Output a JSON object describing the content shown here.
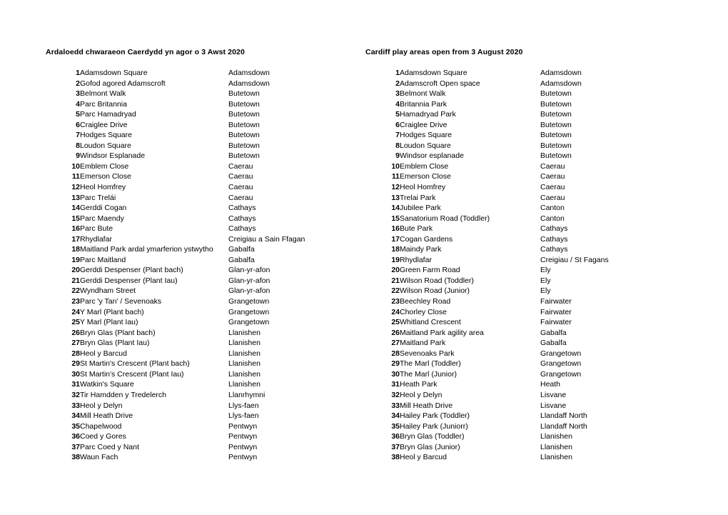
{
  "document": {
    "heading_left": "Ardaloedd chwaraeon Caerdydd yn agor o 3 Awst 2020",
    "heading_right": "Cardiff play areas open from 3 August 2020",
    "text_color": "#000000",
    "background_color": "#ffffff"
  },
  "tables": {
    "welsh": {
      "rows": [
        {
          "num": "1",
          "name": "Adamsdown Square",
          "area": "Adamsdown"
        },
        {
          "num": "2",
          "name": "Gofod agored Adamscroft",
          "area": "Adamsdown"
        },
        {
          "num": "3",
          "name": "Belmont Walk",
          "area": "Butetown"
        },
        {
          "num": "4",
          "name": "Parc Britannia",
          "area": "Butetown"
        },
        {
          "num": "5",
          "name": "Parc Hamadryad",
          "area": "Butetown"
        },
        {
          "num": "6",
          "name": "Craiglee Drive",
          "area": "Butetown"
        },
        {
          "num": "7",
          "name": "Hodges Square",
          "area": "Butetown"
        },
        {
          "num": "8",
          "name": "Loudon Square",
          "area": "Butetown"
        },
        {
          "num": "9",
          "name": "Windsor Esplanade",
          "area": "Butetown"
        },
        {
          "num": "10",
          "name": "Emblem Close",
          "area": "Caerau"
        },
        {
          "num": "11",
          "name": "Emerson Close",
          "area": "Caerau"
        },
        {
          "num": "12",
          "name": "Heol Homfrey",
          "area": "Caerau"
        },
        {
          "num": "13",
          "name": "Parc Trelái",
          "area": "Caerau"
        },
        {
          "num": "14",
          "name": "Gerddi Cogan",
          "area": "Cathays"
        },
        {
          "num": "15",
          "name": "Parc Maendy",
          "area": "Cathays"
        },
        {
          "num": "16",
          "name": "Parc Bute",
          "area": "Cathays"
        },
        {
          "num": "17",
          "name": "Rhydlafar",
          "area": "Creigiau a Sain Ffagan"
        },
        {
          "num": "18",
          "name": "Maitland Park ardal ymarferion ystwytho",
          "area": "Gabalfa"
        },
        {
          "num": "19",
          "name": "Parc Maitland",
          "area": "Gabalfa"
        },
        {
          "num": "20",
          "name": "Gerddi Despenser (Plant bach)",
          "area": "Glan-yr-afon"
        },
        {
          "num": "21",
          "name": "Gerddi Despenser (Plant Iau)",
          "area": "Glan-yr-afon"
        },
        {
          "num": "22",
          "name": "Wyndham Street",
          "area": "Glan-yr-afon"
        },
        {
          "num": "23",
          "name": "Parc 'y Tan' / Sevenoaks",
          "area": "Grangetown"
        },
        {
          "num": "24",
          "name": "Y Marl (Plant bach)",
          "area": "Grangetown"
        },
        {
          "num": "25",
          "name": "Y Marl (Plant Iau)",
          "area": "Grangetown"
        },
        {
          "num": "26",
          "name": "Bryn Glas (Plant bach)",
          "area": "Llanishen"
        },
        {
          "num": "27",
          "name": "Bryn Glas (Plant Iau)",
          "area": "Llanishen"
        },
        {
          "num": "28",
          "name": "Heol y Barcud",
          "area": "Llanishen"
        },
        {
          "num": "29",
          "name": "St Martin's Crescent (Plant bach)",
          "area": "Llanishen"
        },
        {
          "num": "30",
          "name": "St Martin's Crescent (Plant Iau)",
          "area": "Llanishen"
        },
        {
          "num": "31",
          "name": "Watkin's Square",
          "area": "Llanishen"
        },
        {
          "num": "32",
          "name": "Tir Hamdden y Tredelerch",
          "area": "Llanrhymni"
        },
        {
          "num": "33",
          "name": "Heol y Delyn",
          "area": "Llys-faen"
        },
        {
          "num": "34",
          "name": "Mill Heath Drive",
          "area": "Llys-faen"
        },
        {
          "num": "35",
          "name": "Chapelwood",
          "area": "Pentwyn"
        },
        {
          "num": "36",
          "name": "Coed y Gores",
          "area": "Pentwyn"
        },
        {
          "num": "37",
          "name": "Parc Coed y Nant",
          "area": "Pentwyn"
        },
        {
          "num": "38",
          "name": "Waun Fach",
          "area": "Pentwyn"
        }
      ]
    },
    "english": {
      "rows": [
        {
          "num": "1",
          "name": "Adamsdown Square",
          "area": "Adamsdown"
        },
        {
          "num": "2",
          "name": "Adamscroft Open space",
          "area": "Adamsdown"
        },
        {
          "num": "3",
          "name": "Belmont Walk",
          "area": "Butetown"
        },
        {
          "num": "4",
          "name": "Britannia Park",
          "area": "Butetown"
        },
        {
          "num": "5",
          "name": "Hamadryad Park",
          "area": "Butetown"
        },
        {
          "num": "6",
          "name": "Craiglee Drive",
          "area": "Butetown"
        },
        {
          "num": "7",
          "name": "Hodges Square",
          "area": "Butetown"
        },
        {
          "num": "8",
          "name": "Loudon Square",
          "area": "Butetown"
        },
        {
          "num": "9",
          "name": "Windsor esplanade",
          "area": "Butetown"
        },
        {
          "num": "10",
          "name": "Emblem Close",
          "area": "Caerau"
        },
        {
          "num": "11",
          "name": "Emerson Close",
          "area": "Caerau"
        },
        {
          "num": "12",
          "name": "Heol Homfrey",
          "area": "Caerau"
        },
        {
          "num": "13",
          "name": "Trelai Park",
          "area": "Caerau"
        },
        {
          "num": "14",
          "name": "Jubilee Park",
          "area": "Canton"
        },
        {
          "num": "15",
          "name": "Sanatorium Road (Toddler)",
          "area": "Canton"
        },
        {
          "num": "16",
          "name": "Bute Park",
          "area": "Cathays"
        },
        {
          "num": "17",
          "name": "Cogan Gardens",
          "area": "Cathays"
        },
        {
          "num": "18",
          "name": "Maindy Park",
          "area": "Cathays"
        },
        {
          "num": "19",
          "name": "Rhydlafar",
          "area": "Creigiau / St Fagans"
        },
        {
          "num": "20",
          "name": "Green Farm Road",
          "area": "Ely"
        },
        {
          "num": "21",
          "name": "Wilson Road (Toddler)",
          "area": "Ely"
        },
        {
          "num": "22",
          "name": "Wilson Road (Junior)",
          "area": "Ely"
        },
        {
          "num": "23",
          "name": "Beechley Road",
          "area": "Fairwater"
        },
        {
          "num": "24",
          "name": "Chorley Close",
          "area": "Fairwater"
        },
        {
          "num": "25",
          "name": "Whitland Crescent",
          "area": "Fairwater"
        },
        {
          "num": "26",
          "name": "Maitland Park agility area",
          "area": "Gabalfa"
        },
        {
          "num": "27",
          "name": "Maitland Park",
          "area": "Gabalfa"
        },
        {
          "num": "28",
          "name": "Sevenoaks Park",
          "area": "Grangetown"
        },
        {
          "num": "29",
          "name": "The Marl (Toddler)",
          "area": "Grangetown"
        },
        {
          "num": "30",
          "name": "The Marl (Junior)",
          "area": "Grangetown"
        },
        {
          "num": "31",
          "name": "Heath Park",
          "area": "Heath"
        },
        {
          "num": "32",
          "name": "Heol y Delyn",
          "area": "Lisvane"
        },
        {
          "num": "33",
          "name": "Mill Heath Drive",
          "area": "Lisvane"
        },
        {
          "num": "34",
          "name": "Hailey Park (Toddler)",
          "area": "Llandaff North"
        },
        {
          "num": "35",
          "name": "Hailey Park (Juniorr)",
          "area": "Llandaff North"
        },
        {
          "num": "36",
          "name": "Bryn Glas (Toddler)",
          "area": "Llanishen"
        },
        {
          "num": "37",
          "name": "Bryn Glas (Junior)",
          "area": "Llanishen"
        },
        {
          "num": "38",
          "name": "Heol y Barcud",
          "area": "Llanishen"
        }
      ]
    }
  }
}
